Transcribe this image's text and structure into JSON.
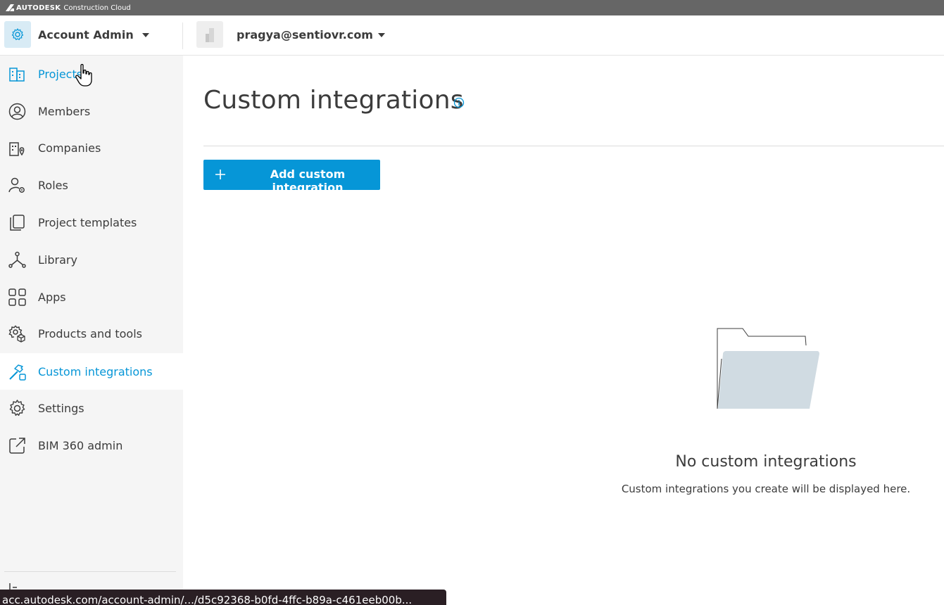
{
  "topbar": {
    "brand": "AUTODESK",
    "product": "Construction Cloud"
  },
  "header": {
    "account_title": "Account Admin",
    "user_email": "pragya@sentiovr.com"
  },
  "sidebar": {
    "items": [
      {
        "label": "Projects",
        "icon": "building-icon"
      },
      {
        "label": "Members",
        "icon": "user-circle-icon"
      },
      {
        "label": "Companies",
        "icon": "company-location-icon"
      },
      {
        "label": "Roles",
        "icon": "user-gear-icon"
      },
      {
        "label": "Project templates",
        "icon": "copy-template-icon"
      },
      {
        "label": "Library",
        "icon": "library-nodes-icon"
      },
      {
        "label": "Apps",
        "icon": "apps-grid-icon"
      },
      {
        "label": "Products and tools",
        "icon": "gear-cube-icon"
      },
      {
        "label": "Custom integrations",
        "icon": "hammer-icon"
      },
      {
        "label": "Settings",
        "icon": "gear-icon"
      },
      {
        "label": "BIM 360 admin",
        "icon": "external-link-icon"
      }
    ],
    "active": "Custom integrations"
  },
  "main": {
    "title": "Custom integrations",
    "add_button_label": "Add custom integration",
    "empty_title": "No custom integrations",
    "empty_subtitle": "Custom integrations you create will be displayed here."
  },
  "status_bar": {
    "url": "acc.autodesk.com/account-admin/.../d5c92368-b0fd-4ffc-b89a-c461eeb00b..."
  },
  "colors": {
    "accent": "#0696d7",
    "topbar": "#666666",
    "sidebar_bg": "#f5f5f5",
    "folder_fill": "#d0dbe2"
  }
}
